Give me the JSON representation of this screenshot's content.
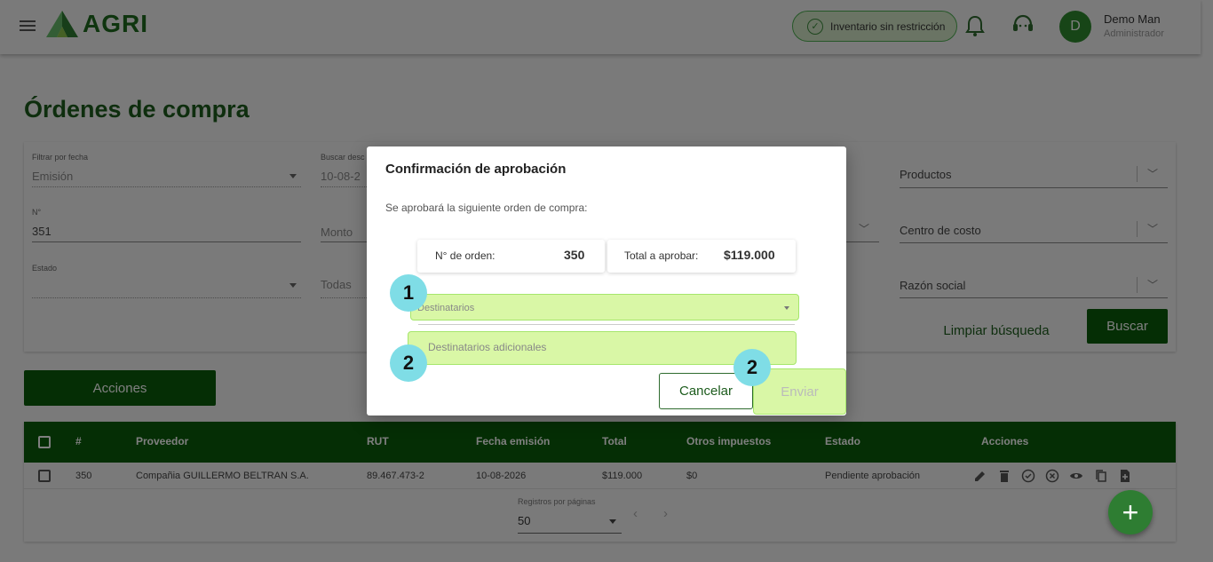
{
  "header": {
    "brand": "AGRI",
    "status": "Inventario sin restricción",
    "user_initial": "D",
    "user_name": "Demo Man",
    "user_role": "Administrador"
  },
  "page": {
    "title": "Órdenes de compra"
  },
  "filters": {
    "date_filter_label": "Filtrar por fecha",
    "date_filter_value": "Emisión",
    "search_desc_label": "Buscar desc",
    "search_desc_value": "10-08-2",
    "number_label": "N°",
    "number_value": "351",
    "amount_placeholder": "Monto",
    "state_label": "Estado",
    "state_todas": "Todas",
    "products": "Productos",
    "cost_center": "Centro de costo",
    "business_name": "Razón social",
    "clear_button": "Limpiar búsqueda",
    "search_button": "Buscar"
  },
  "actions_button": "Acciones",
  "table": {
    "headers": [
      "#",
      "Proveedor",
      "RUT",
      "Fecha emisión",
      "Total",
      "Otros impuestos",
      "Estado",
      "Acciones"
    ],
    "rows": [
      {
        "num": "350",
        "provider": "Compañia GUILLERMO BELTRAN S.A.",
        "rut": "89.467.473-2",
        "date": "10-08-2026",
        "total": "$119.000",
        "taxes": "$0",
        "status": "Pendiente aprobación"
      }
    ],
    "pagination_label": "Registros por páginas",
    "pagination_value": "50"
  },
  "modal": {
    "title": "Confirmación de aprobación",
    "subtitle": "Se aprobará la siguiente orden de compra:",
    "order_label": "N° de orden:",
    "order_value": "350",
    "total_label": "Total a aprobar:",
    "total_value": "$119.000",
    "recipients_placeholder": "Destinatarios",
    "additional_placeholder": "Destinatarios adicionales",
    "cancel": "Cancelar",
    "send": "Enviar",
    "badges": [
      "1",
      "2",
      "2"
    ]
  },
  "colors": {
    "primary": "#0b5d0b",
    "highlight": "#d9f7a6",
    "badge": "#7fdde6"
  }
}
